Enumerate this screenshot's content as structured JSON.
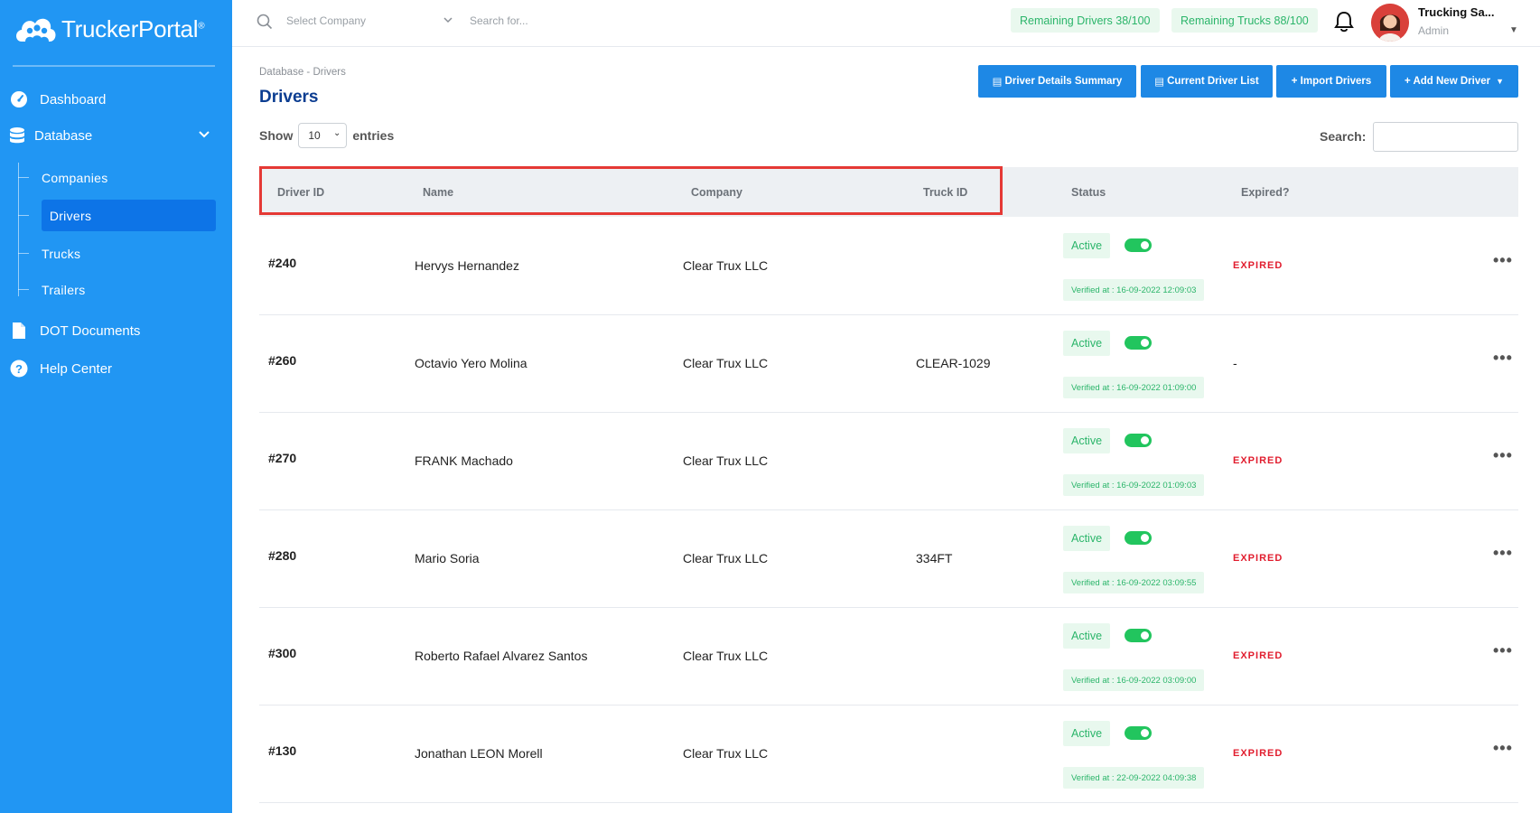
{
  "brand": {
    "name": "TruckerPortal",
    "mark": "®"
  },
  "sidebar": {
    "items": [
      {
        "label": "Dashboard",
        "icon": "dashboard-icon"
      },
      {
        "label": "Database",
        "icon": "database-icon"
      },
      {
        "label": "DOT Documents",
        "icon": "document-icon"
      },
      {
        "label": "Help Center",
        "icon": "help-icon"
      }
    ],
    "sub_items": [
      {
        "label": "Companies"
      },
      {
        "label": "Drivers"
      },
      {
        "label": "Trucks"
      },
      {
        "label": "Trailers"
      }
    ]
  },
  "topbar": {
    "company_placeholder": "Select Company",
    "search_placeholder": "Search for...",
    "remaining_drivers": "Remaining Drivers 38/100",
    "remaining_trucks": "Remaining Trucks 88/100",
    "user_name": "Trucking Sa...",
    "user_role": "Admin"
  },
  "page": {
    "breadcrumb": "Database - Drivers",
    "title": "Drivers",
    "buttons": {
      "details_summary": "Driver Details Summary",
      "current_list": "Current Driver List",
      "import": "+ Import Drivers",
      "add_new": "+ Add New Driver"
    },
    "show_label": "Show",
    "entries_label": "entries",
    "page_size": "10",
    "search_label": "Search:"
  },
  "table": {
    "headers": {
      "driver_id": "Driver ID",
      "name": "Name",
      "company": "Company",
      "truck_id": "Truck ID",
      "status": "Status",
      "expired": "Expired?"
    },
    "rows": [
      {
        "id": "#240",
        "name": "Hervys Hernandez",
        "company": "Clear Trux LLC",
        "truck": "",
        "status": "Active",
        "verified": "Verified at : 16-09-2022 12:09:03",
        "expired": "EXPIRED"
      },
      {
        "id": "#260",
        "name": "Octavio Yero Molina",
        "company": "Clear Trux LLC",
        "truck": "CLEAR-1029",
        "status": "Active",
        "verified": "Verified at : 16-09-2022 01:09:00",
        "expired": "-"
      },
      {
        "id": "#270",
        "name": "FRANK Machado",
        "company": "Clear Trux LLC",
        "truck": "",
        "status": "Active",
        "verified": "Verified at : 16-09-2022 01:09:03",
        "expired": "EXPIRED"
      },
      {
        "id": "#280",
        "name": "Mario Soria",
        "company": "Clear Trux LLC",
        "truck": "334FT",
        "status": "Active",
        "verified": "Verified at : 16-09-2022 03:09:55",
        "expired": "EXPIRED"
      },
      {
        "id": "#300",
        "name": "Roberto Rafael Alvarez Santos",
        "company": "Clear Trux LLC",
        "truck": "",
        "status": "Active",
        "verified": "Verified at : 16-09-2022 03:09:00",
        "expired": "EXPIRED"
      },
      {
        "id": "#130",
        "name": "Jonathan LEON Morell",
        "company": "Clear Trux LLC",
        "truck": "",
        "status": "Active",
        "verified": "Verified at : 22-09-2022 04:09:38",
        "expired": "EXPIRED"
      }
    ]
  }
}
